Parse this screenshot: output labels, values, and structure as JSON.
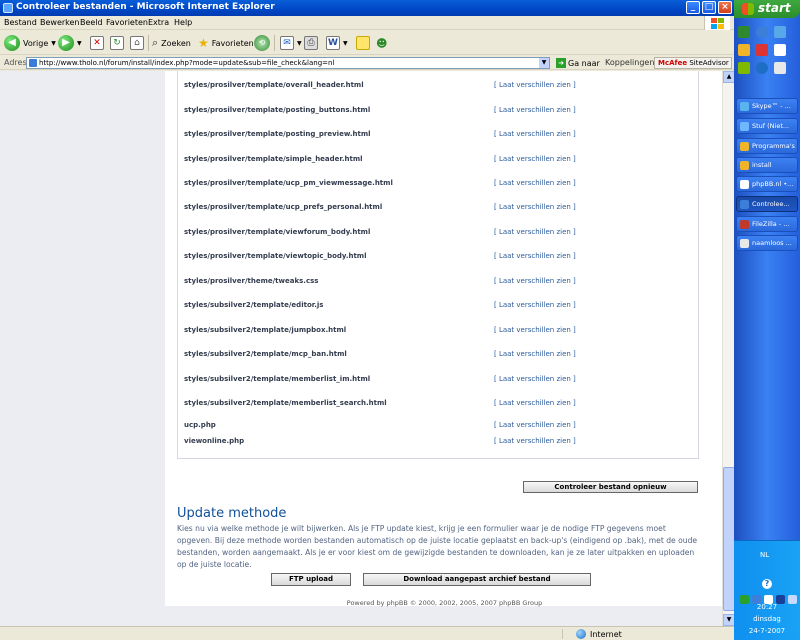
{
  "window": {
    "title": "Controleer bestanden - Microsoft Internet Explorer"
  },
  "menu": [
    "Bestand",
    "Bewerken",
    "Beeld",
    "Favorieten",
    "Extra",
    "Help"
  ],
  "toolbar": {
    "back_label": "Vorige",
    "search_label": "Zoeken",
    "favorites_label": "Favorieten"
  },
  "address": {
    "label": "Adres",
    "url": "http://www.tholo.nl/forum/install/index.php?mode=update&sub=file_check&lang=nl",
    "go_label": "Ga naar",
    "links_label": "Koppelingen",
    "mcafee_brand": "McAfee",
    "mcafee_label": "SiteAdvisor"
  },
  "file_table": {
    "link_text": "[ Laat verschillen zien ]",
    "rows": [
      {
        "path": "styles/prosilver/template/overall_header.html"
      },
      {
        "path": "styles/prosilver/template/posting_buttons.html"
      },
      {
        "path": "styles/prosilver/template/posting_preview.html"
      },
      {
        "path": "styles/prosilver/template/simple_header.html"
      },
      {
        "path": "styles/prosilver/template/ucp_pm_viewmessage.html"
      },
      {
        "path": "styles/prosilver/template/ucp_prefs_personal.html"
      },
      {
        "path": "styles/prosilver/template/viewforum_body.html"
      },
      {
        "path": "styles/prosilver/template/viewtopic_body.html"
      },
      {
        "path": "styles/prosilver/theme/tweaks.css"
      },
      {
        "path": "styles/subsilver2/template/editor.js"
      },
      {
        "path": "styles/subsilver2/template/jumpbox.html"
      },
      {
        "path": "styles/subsilver2/template/mcp_ban.html"
      },
      {
        "path": "styles/subsilver2/template/memberlist_im.html"
      },
      {
        "path": "styles/subsilver2/template/memberlist_search.html"
      },
      {
        "path": "ucp.php"
      },
      {
        "path": "viewonline.php"
      }
    ]
  },
  "recheck_button": "Controleer bestand opnieuw",
  "update": {
    "title": "Update methode",
    "description": "Kies nu via welke methode je wilt bijwerken. Als je FTP update kiest, krijg je een formulier waar je de nodige FTP gegevens moet opgeven. Bij deze methode worden bestanden automatisch op de juiste locatie geplaatst en back-up's (eindigend op .bak), met de oude bestanden, worden aangemaakt. Als je er voor kiest om de gewijzigde bestanden te downloaden, kan je ze later uitpakken en uploaden op de juiste locatie.",
    "ftp_button": "FTP upload",
    "download_button": "Download aangepast archief bestand"
  },
  "footer": "Powered by phpBB © 2000, 2002, 2005, 2007 phpBB Group",
  "statusbar": {
    "zone": "Internet"
  },
  "taskbar": {
    "start_label": "start",
    "tasks": [
      {
        "label": "Skype™ - ..."
      },
      {
        "label": "Stuf (Niet..."
      },
      {
        "label": "Programma's"
      },
      {
        "label": "install"
      },
      {
        "label": "phpBB.nl •..."
      },
      {
        "label": "Controlee..."
      },
      {
        "label": "FileZilla - ..."
      },
      {
        "label": "naamloos ..."
      }
    ],
    "lang": "NL",
    "time": "20:27",
    "day": "dinsdag",
    "date": "24-7-2007"
  },
  "colors": {
    "title_blue": "#0048c8",
    "link": "#2a5b9c",
    "heading": "#115098",
    "taskbar": "#245edb",
    "start_green": "#2b8f2b"
  }
}
